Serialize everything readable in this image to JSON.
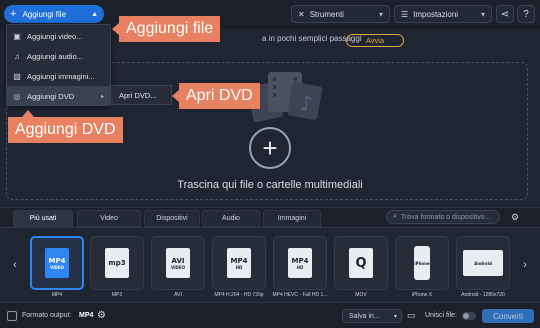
{
  "header": {
    "add_file_button": "Aggiungi file",
    "tools_button": "Strumenti",
    "settings_button": "Impostazioni"
  },
  "promo": {
    "text": "a in pochi semplici passaggi",
    "button": "Avvia"
  },
  "add_menu": {
    "items": [
      {
        "label": "Aggiungi video...",
        "icon": "video-file-icon"
      },
      {
        "label": "Aggiungi audio...",
        "icon": "music-note-icon"
      },
      {
        "label": "Aggiungi immagini...",
        "icon": "image-icon"
      },
      {
        "label": "Aggiungi DVD",
        "icon": "disc-icon"
      }
    ],
    "submenu_item": "Apri DVD..."
  },
  "callouts": {
    "add_file": "Aggiungi file",
    "open_dvd": "Apri DVD",
    "add_dvd": "Aggiungi DVD"
  },
  "dropzone": {
    "text": "Trascina qui file o cartelle multimediali"
  },
  "format_tabs": [
    {
      "label": "Più usati",
      "active": true
    },
    {
      "label": "Video",
      "active": false
    },
    {
      "label": "Dispositivi",
      "active": false
    },
    {
      "label": "Audio",
      "active": false
    },
    {
      "label": "Immagini",
      "active": false
    }
  ],
  "format_search": {
    "placeholder": "Trova formato o dispositivo..."
  },
  "formats": [
    {
      "label": "MP4",
      "icon_text": "MP4",
      "icon_sub": "VIDEO",
      "selected": true
    },
    {
      "label": "MP3",
      "icon_text": "mp3",
      "icon_sub": "",
      "selected": false
    },
    {
      "label": "AVI",
      "icon_text": "AVI",
      "icon_sub": "VIDEO",
      "selected": false
    },
    {
      "label": "MP4 H.264 - HD 720p",
      "icon_text": "MP4",
      "icon_sub": "HD",
      "selected": false
    },
    {
      "label": "MP4 HEVC - Full HD 1...",
      "icon_text": "MP4",
      "icon_sub": "HD",
      "selected": false
    },
    {
      "label": "MOV",
      "icon_text": "Q",
      "icon_sub": "",
      "selected": false
    },
    {
      "label": "iPhone X",
      "icon_text": "iPhone",
      "icon_sub": "",
      "selected": false
    },
    {
      "label": "Android - 1280x720",
      "icon_text": "Android",
      "icon_sub": "",
      "selected": false
    }
  ],
  "footer": {
    "output_label": "Formato output:",
    "output_value": "MP4",
    "save_in": "Salva in...",
    "merge_label": "Unisci file:",
    "merge_enabled": false,
    "convert_button": "Converti"
  },
  "colors": {
    "accent": "#1e6fd9",
    "callout": "#e88161",
    "promo": "#e2a646"
  }
}
